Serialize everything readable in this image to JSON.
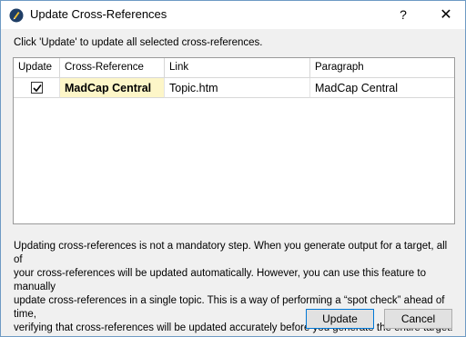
{
  "window": {
    "title": "Update Cross-References",
    "help_label": "?",
    "close_label": "✕",
    "app_icon": "madcap-quill-icon"
  },
  "instruction": "Click 'Update' to update all selected cross-references.",
  "table": {
    "columns": [
      "Update",
      "Cross-Reference",
      "Link",
      "Paragraph"
    ],
    "rows": [
      {
        "update_checked": true,
        "cross_reference": "MadCap Central",
        "link": "Topic.htm",
        "paragraph": "MadCap Central"
      }
    ]
  },
  "footnote": {
    "lines": [
      "Updating cross-references is not a mandatory step. When you generate output for a target, all of",
      "your cross-references will be updated automatically. However, you can use this feature to manually",
      "update cross-references in a single topic. This is a way of performing a “spot check” ahead of time,",
      "verifying that cross-references will be updated accurately before you generate the entire target."
    ]
  },
  "buttons": {
    "update_label": "Update",
    "cancel_label": "Cancel"
  },
  "colors": {
    "accent": "#0078d7",
    "row_highlight": "#fdf6c8"
  }
}
